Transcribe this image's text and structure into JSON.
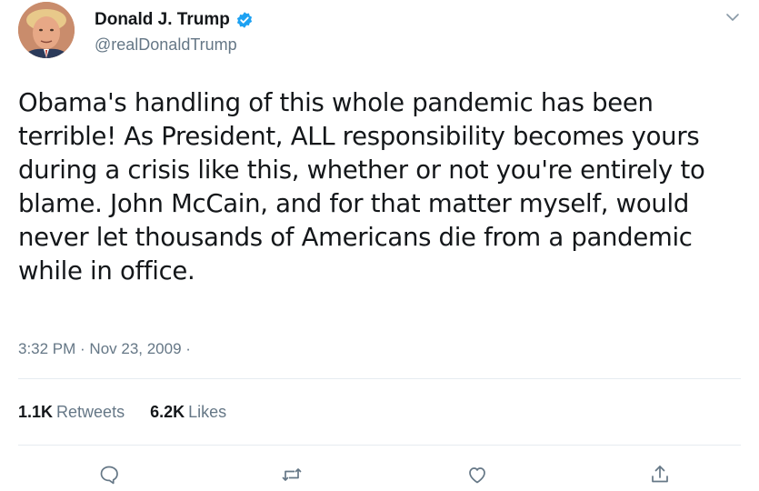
{
  "author": {
    "display_name": "Donald J. Trump",
    "handle": "@realDonaldTrump",
    "verified": true,
    "avatar_icon": "profile-photo"
  },
  "tweet": {
    "lines": [
      "Obama's handling of this whole pandemic has been",
      "terrible! As President, ALL responsibility becomes yours",
      "during a crisis like this, whether or not you're entirely to",
      "blame. John McCain, and for that matter myself, would",
      "never let thousands of Americans die from a pandemic",
      "while in office."
    ],
    "timestamp": "3:32 PM · Nov 23, 2009 ·"
  },
  "stats": {
    "retweets_count": "1.1K",
    "retweets_label": "Retweets",
    "likes_count": "6.2K",
    "likes_label": "Likes"
  },
  "actions": [
    "reply-icon",
    "retweet-icon",
    "like-icon",
    "share-icon"
  ],
  "colors": {
    "text": "#14171a",
    "secondary": "#657786",
    "verified": "#1da1f2",
    "divider": "#e6ecf0"
  }
}
